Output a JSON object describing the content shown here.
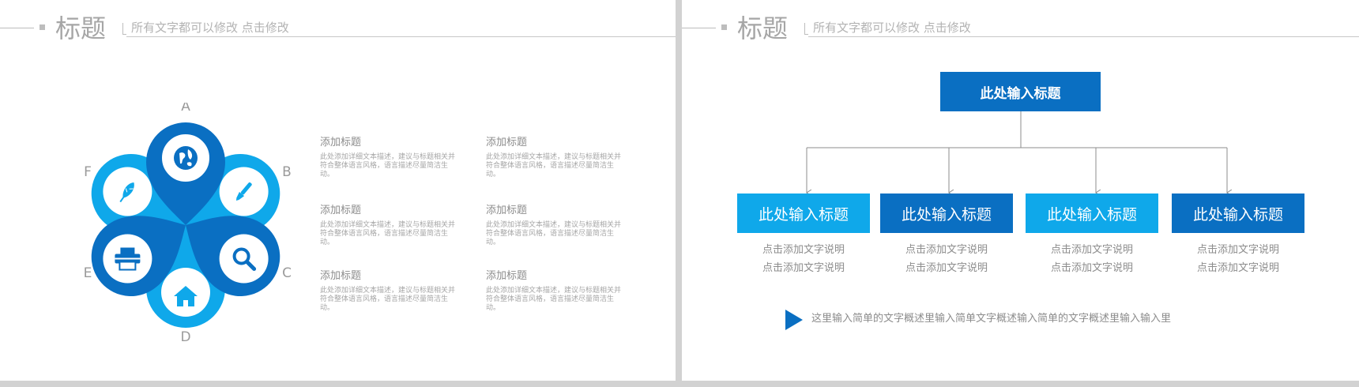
{
  "left_slide": {
    "header": {
      "title": "标题",
      "subtitle": "所有文字都可以修改   点击修改"
    },
    "flower": {
      "letters": [
        "A",
        "B",
        "C",
        "D",
        "E",
        "F"
      ],
      "icons": [
        "globe-icon",
        "brush-icon",
        "search-icon",
        "home-icon",
        "printer-icon",
        "feather-icon"
      ]
    },
    "text_blocks": [
      {
        "title": "添加标题",
        "body": "此处添加详细文本描述，建议与标题相关并符合整体语言风格，语言描述尽量简洁生动。"
      },
      {
        "title": "添加标题",
        "body": "此处添加详细文本描述，建议与标题相关并符合整体语言风格，语言描述尽量简洁生动。"
      },
      {
        "title": "添加标题",
        "body": "此处添加详细文本描述，建议与标题相关并符合整体语言风格，语言描述尽量简洁生动。"
      },
      {
        "title": "添加标题",
        "body": "此处添加详细文本描述，建议与标题相关并符合整体语言风格，语言描述尽量简洁生动。"
      },
      {
        "title": "添加标题",
        "body": "此处添加详细文本描述，建议与标题相关并符合整体语言风格，语言描述尽量简洁生动。"
      },
      {
        "title": "添加标题",
        "body": "此处添加详细文本描述，建议与标题相关并符合整体语言风格，语言描述尽量简洁生动。"
      }
    ]
  },
  "right_slide": {
    "header": {
      "title": "标题",
      "subtitle": "所有文字都可以修改   点击修改"
    },
    "org": {
      "top_label": "此处输入标题",
      "children": [
        {
          "label": "此处输入标题",
          "desc1": "点击添加文字说明",
          "desc2": "点击添加文字说明"
        },
        {
          "label": "此处输入标题",
          "desc1": "点击添加文字说明",
          "desc2": "点击添加文字说明"
        },
        {
          "label": "此处输入标题",
          "desc1": "点击添加文字说明",
          "desc2": "点击添加文字说明"
        },
        {
          "label": "此处输入标题",
          "desc1": "点击添加文字说明",
          "desc2": "点击添加文字说明"
        }
      ]
    },
    "summary": "这里输入简单的文字概述里输入简单文字概述输入简单的文字概述里输入输入里"
  },
  "colors": {
    "dark_blue": "#0a6fc2",
    "light_blue": "#0fa8ea",
    "gray_text": "#8c8c8c"
  }
}
